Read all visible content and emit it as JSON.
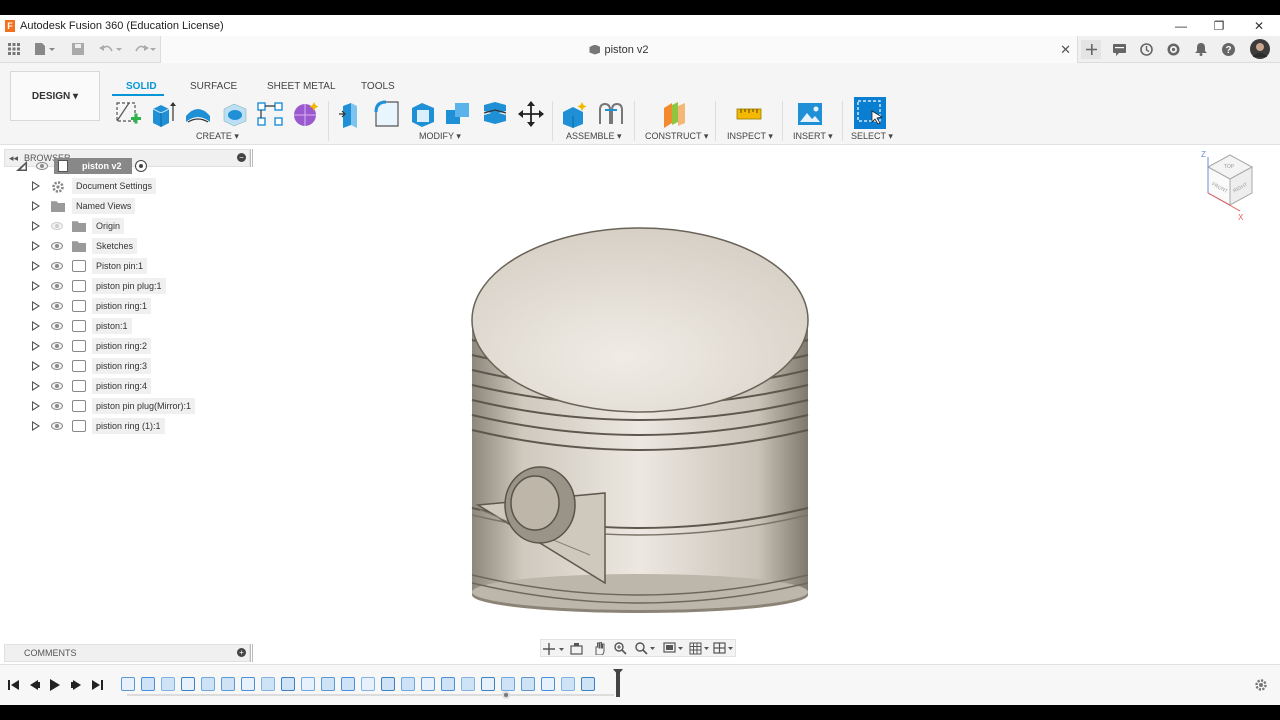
{
  "window": {
    "title": "Autodesk Fusion 360 (Education License)",
    "logo_letter": "F",
    "minimize": "—",
    "maximize": "❐",
    "close": "✕"
  },
  "document_tab": {
    "title": "piston v2",
    "close": "✕"
  },
  "ribbon": {
    "workspace_label": "DESIGN ▾",
    "tabs": [
      {
        "label": "SOLID",
        "active": true
      },
      {
        "label": "SURFACE",
        "active": false
      },
      {
        "label": "SHEET METAL",
        "active": false
      },
      {
        "label": "TOOLS",
        "active": false
      }
    ],
    "groups": [
      {
        "label": "CREATE ▾"
      },
      {
        "label": "MODIFY ▾"
      },
      {
        "label": "ASSEMBLE ▾"
      },
      {
        "label": "CONSTRUCT ▾"
      },
      {
        "label": "INSPECT ▾"
      },
      {
        "label": "INSERT ▾"
      },
      {
        "label": "SELECT ▾"
      }
    ],
    "accent_color": "#0696d7"
  },
  "browser": {
    "header": "BROWSER",
    "root": "piston v2",
    "items": [
      {
        "label": "Document Settings",
        "icon": "gear-icon"
      },
      {
        "label": "Named Views",
        "icon": "folder-icon"
      },
      {
        "label": "Origin",
        "icon": "folder-icon"
      },
      {
        "label": "Sketches",
        "icon": "folder-icon"
      },
      {
        "label": "Piston pin:1",
        "icon": "component-icon"
      },
      {
        "label": "piston pin plug:1",
        "icon": "component-icon"
      },
      {
        "label": "pistion ring:1",
        "icon": "component-icon"
      },
      {
        "label": "piston:1",
        "icon": "component-icon"
      },
      {
        "label": "pistion ring:2",
        "icon": "component-icon"
      },
      {
        "label": "pistion ring:3",
        "icon": "component-icon"
      },
      {
        "label": "pistion ring:4",
        "icon": "component-icon"
      },
      {
        "label": "piston pin plug(Mirror):1",
        "icon": "component-icon"
      },
      {
        "label": "pistion ring (1):1",
        "icon": "component-icon"
      }
    ]
  },
  "comments": {
    "header": "COMMENTS"
  },
  "viewcube": {
    "top": "TOP",
    "front": "FRONT",
    "right": "RIGHT",
    "axis_z": "Z",
    "axis_x": "X"
  }
}
